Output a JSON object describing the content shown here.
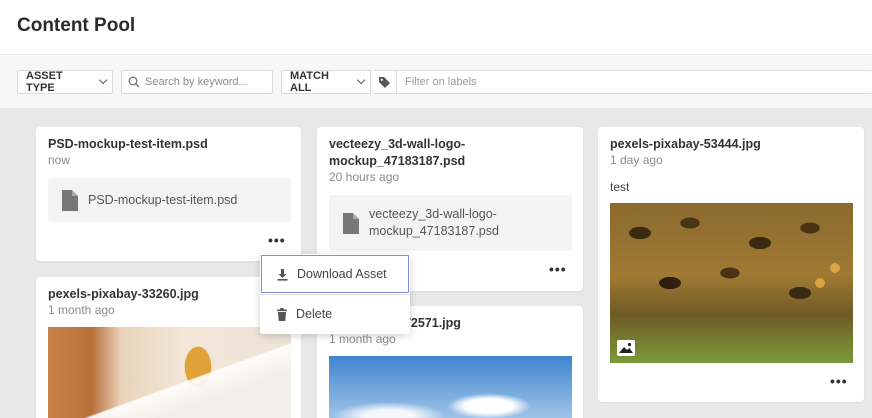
{
  "header": {
    "title": "Content Pool"
  },
  "filters": {
    "asset_type_label": "ASSET TYPE",
    "search_placeholder": "Search by keyword...",
    "match_label": "MATCH ALL",
    "labels_placeholder": "Filter on labels"
  },
  "cards": [
    {
      "title": "PSD-mockup-test-item.psd",
      "time": "now",
      "file_name": "PSD-mockup-test-item.psd",
      "more": "•••"
    },
    {
      "title_line1": "vecteezy_3d-wall-logo-",
      "title_line2": "mockup_47183187.psd",
      "time": "20 hours ago",
      "file_line1": "vecteezy_3d-wall-logo-",
      "file_line2": "mockup_47183187.psd",
      "more": "•••"
    },
    {
      "title": "pexels-pixabay-53444.jpg",
      "time": "1 day ago",
      "description": "test",
      "image_icon": "image-icon",
      "more": "•••"
    },
    {
      "title": "pexels-pixabay-33260.jpg",
      "time": "1 month ago"
    },
    {
      "title_partial": "772571.jpg",
      "time": "1 month ago"
    }
  ],
  "context_menu": {
    "items": [
      {
        "label": "Download Asset",
        "icon": "download-icon"
      },
      {
        "label": "Delete",
        "icon": "trash-icon"
      }
    ]
  },
  "colors": {
    "grid_bg": "#e8e8e8",
    "menu_focus": "#7b8ee0"
  }
}
